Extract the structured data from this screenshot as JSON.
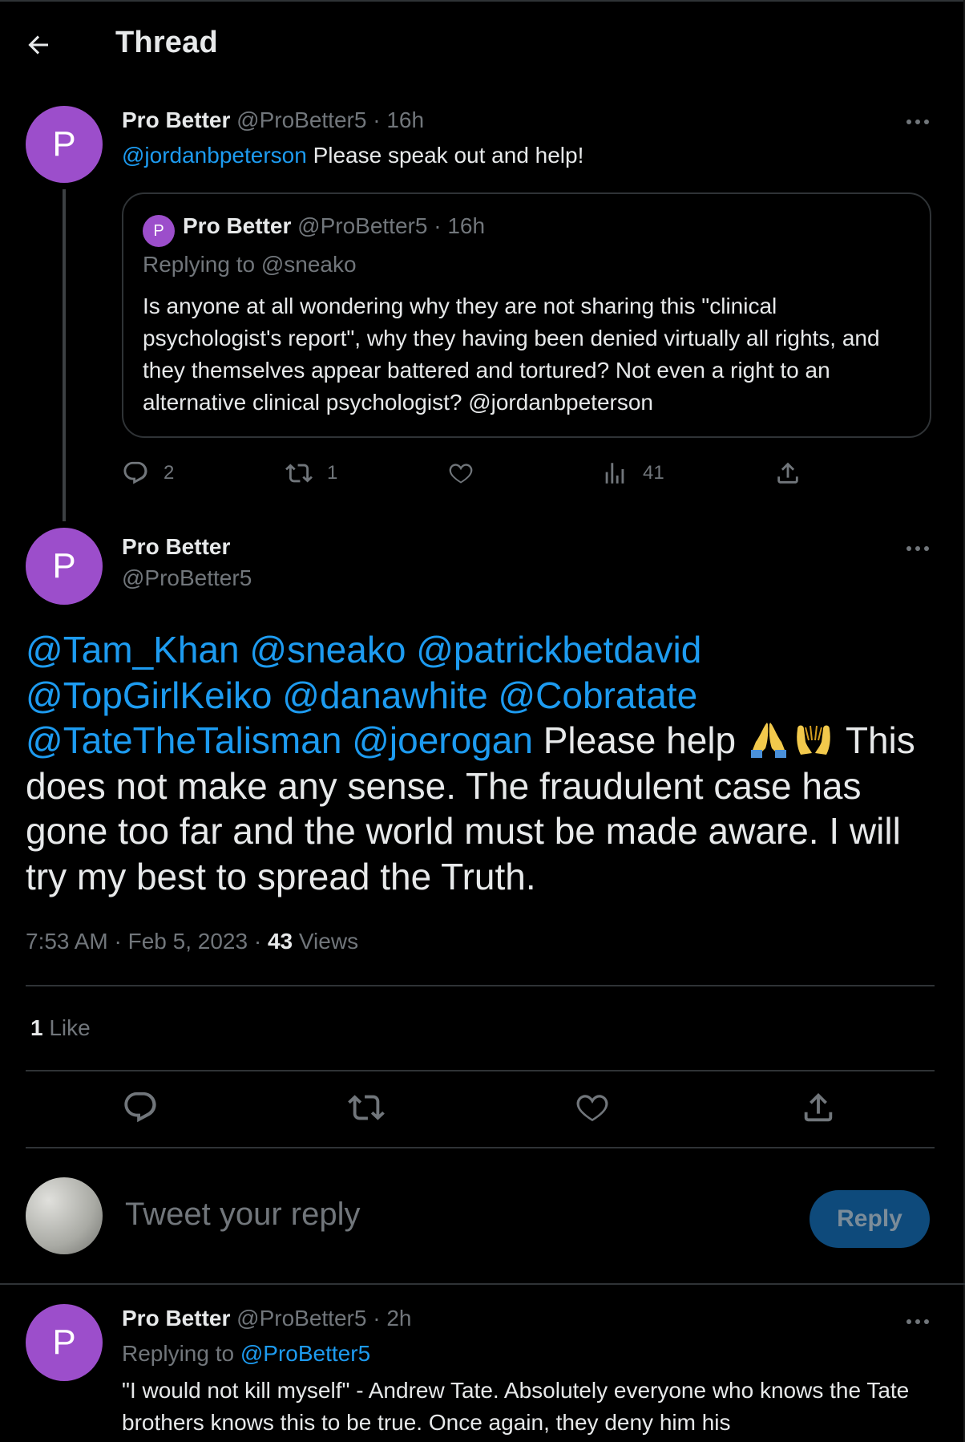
{
  "header": {
    "title": "Thread",
    "back_icon": "arrow-left-icon"
  },
  "colors": {
    "background": "#000000",
    "text": "#e7e9ea",
    "muted": "#71767b",
    "link": "#1d9bf0",
    "avatar": "#9c4ecb",
    "reply_button": "#0e4a7b"
  },
  "tweet1": {
    "avatar_letter": "P",
    "name": "Pro Better",
    "handle": "@ProBetter5",
    "time": "· 16h",
    "mention": "@jordanbpeterson",
    "text": " Please speak out and help!",
    "quote": {
      "avatar_letter": "P",
      "name": "Pro Better",
      "handle": "@ProBetter5",
      "time": "· 16h",
      "replying_to": "Replying to @sneako",
      "text": "Is anyone at all wondering why they are not sharing this \"clinical psychologist's report\", why they having been denied virtually all rights, and they themselves appear battered and tortured?  Not even a right to an alternative clinical psychologist? @jordanbpeterson"
    },
    "stats": {
      "replies": "2",
      "retweets": "1",
      "views": "41"
    }
  },
  "main_tweet": {
    "avatar_letter": "P",
    "name": "Pro Better",
    "handle": "@ProBetter5",
    "mentions_line1": "@Tam_Khan @sneako @patrickbetdavid",
    "mentions_line2": "@TopGirlKeiko @danawhite @Cobratate",
    "mentions_line3": "@TateTheTalisman @joerogan",
    "text_a": " Please help ",
    "text_b": " This does not make any sense.  The fraudulent case has gone too far and the world must be made aware.  I will try my best to spread the Truth.",
    "emojis": [
      "folded-hands-emoji",
      "palms-up-emoji"
    ],
    "time": "7:53 AM · Feb 5, 2023 · ",
    "views_count": "43",
    "views_label": " Views",
    "likes_count": "1",
    "likes_label": " Like"
  },
  "composer": {
    "placeholder": "Tweet your reply",
    "button": "Reply"
  },
  "tweet3": {
    "avatar_letter": "P",
    "name": "Pro Better",
    "handle": "@ProBetter5",
    "time": "· 2h",
    "replying_prefix": "Replying to ",
    "replying_handle": "@ProBetter5",
    "text": "\"I would not kill myself\" - Andrew Tate. Absolutely everyone who knows the Tate brothers knows this to be true.  Once again, they deny him his"
  }
}
